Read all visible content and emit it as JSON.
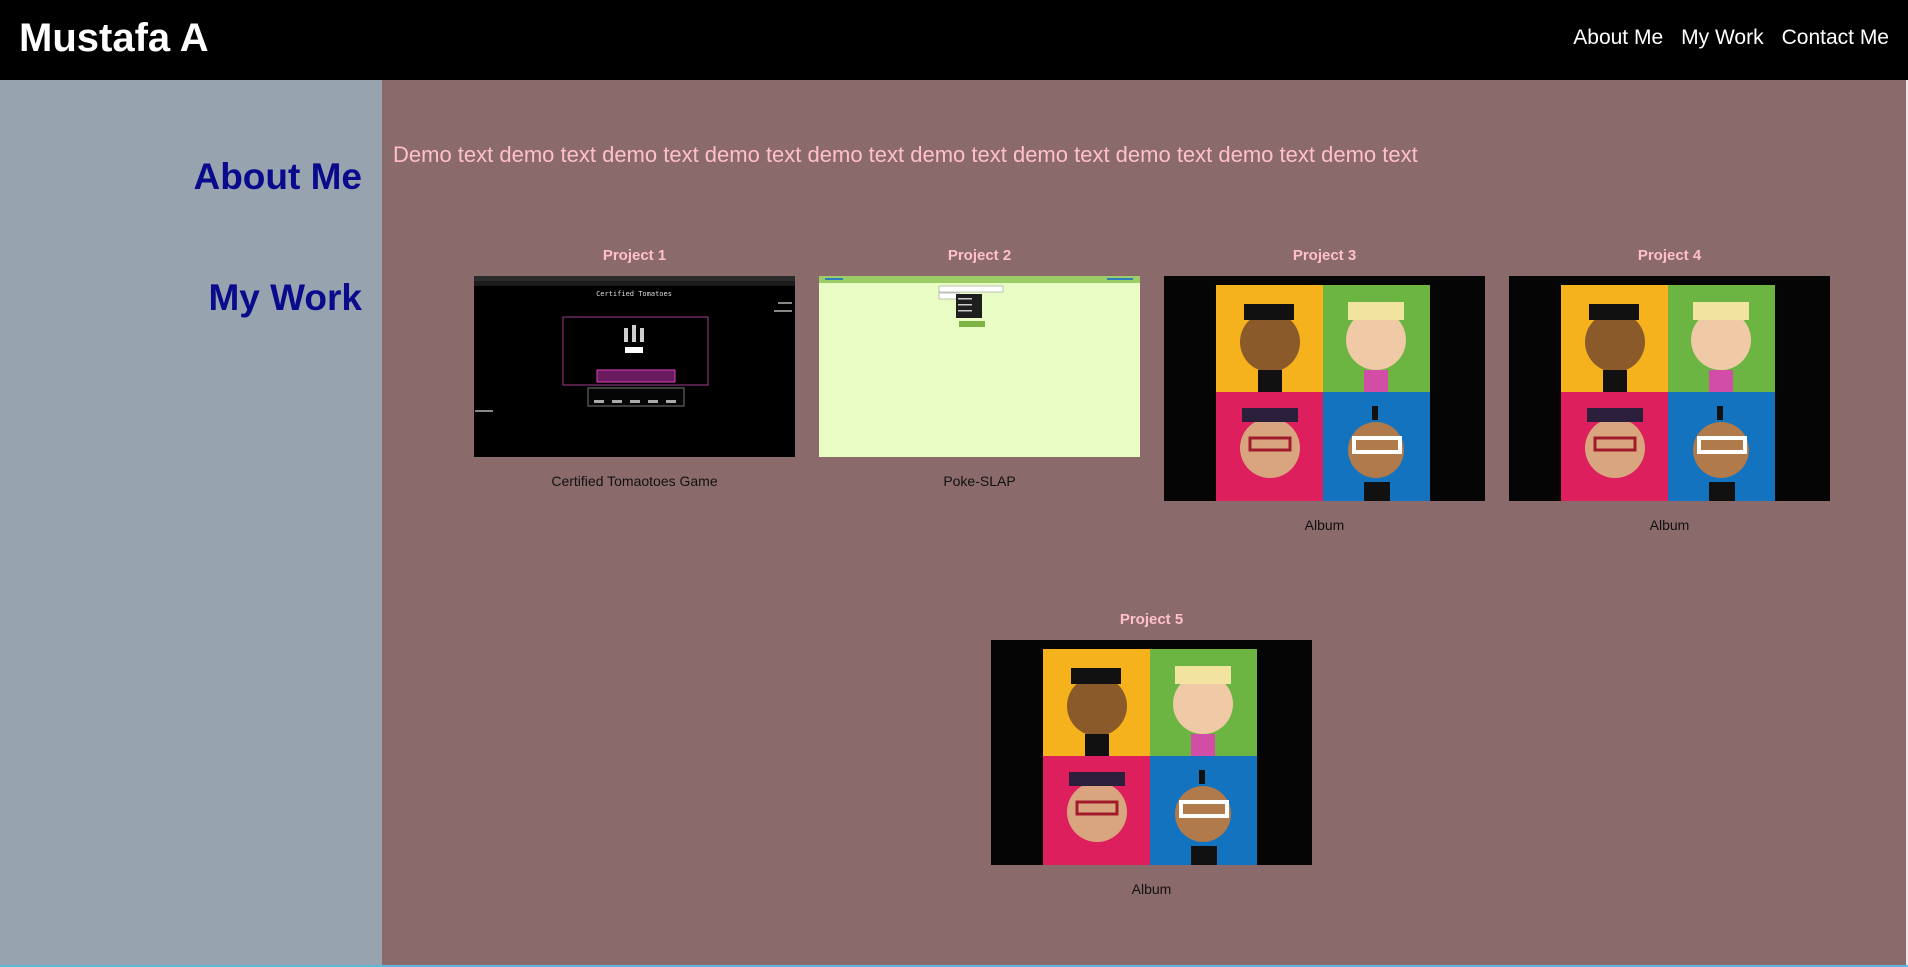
{
  "header": {
    "title": "Mustafa A",
    "nav": [
      "About Me",
      "My Work",
      "Contact Me"
    ]
  },
  "sidebar": {
    "items": [
      "About Me",
      "My Work"
    ]
  },
  "main": {
    "intro": "Demo text demo text demo text demo text demo text demo text demo text demo text demo text demo text",
    "projects": [
      {
        "title": "Project 1",
        "caption": "Certified Tomaotoes Game",
        "thumb": "game-screenshot"
      },
      {
        "title": "Project 2",
        "caption": "Poke-SLAP",
        "thumb": "web-app-screenshot"
      },
      {
        "title": "Project 3",
        "caption": "Album",
        "thumb": "album-art"
      },
      {
        "title": "Project 4",
        "caption": "Album",
        "thumb": "album-art"
      },
      {
        "title": "Project 5",
        "caption": "Album",
        "thumb": "album-art"
      }
    ],
    "game_thumb_text": {
      "title": "Certified Tomatoes"
    }
  },
  "colors": {
    "header_bg": "#000000",
    "sidebar_bg": "#97a3ae",
    "main_bg": "#8b6a6c",
    "accent_text": "#ffc0cb",
    "sidebar_link": "#0a0a8c",
    "poke_bg": "#e8fcc4",
    "poke_bar": "#9ccc65",
    "album_tiles": [
      "#f5b21c",
      "#6db543",
      "#de1f5d",
      "#1473bf"
    ]
  }
}
